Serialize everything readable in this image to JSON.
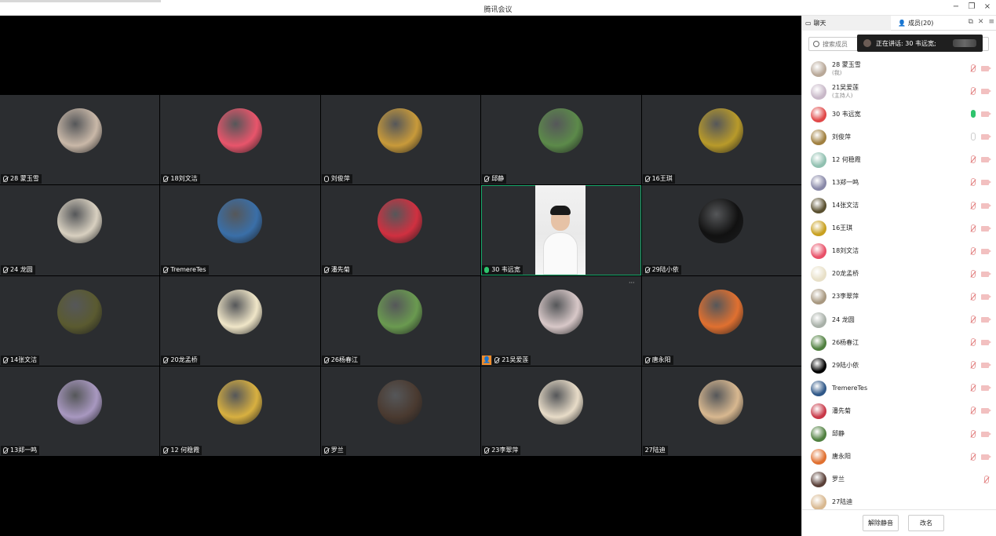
{
  "window": {
    "title": "腾讯会议",
    "controls": [
      "−",
      "❐",
      "×"
    ]
  },
  "colors": {
    "stage_bg": "#000000",
    "tile_bg": "#2b2d30",
    "active_border": "#1aad6f",
    "host_badge": "#f08c2a",
    "muted_red": "#e07070",
    "speaking_green": "#2ec46d"
  },
  "grid": {
    "tiles": [
      {
        "name": "28 蒙玉雪",
        "mic": "muted",
        "avatar_color": "#c9b8a8"
      },
      {
        "name": "18刘文洁",
        "mic": "muted",
        "avatar_color": "#e8556b"
      },
      {
        "name": "刘俊萍",
        "mic": "on",
        "avatar_color": "#c89a3a"
      },
      {
        "name": "邱静",
        "mic": "muted",
        "avatar_color": "#5c8a4a"
      },
      {
        "name": "16王琪",
        "mic": "muted",
        "avatar_color": "#b89a2a"
      },
      {
        "name": "24 龙圆",
        "mic": "muted",
        "avatar_color": "#d8d0c0"
      },
      {
        "name": "TremereTes",
        "mic": "muted",
        "avatar_color": "#3a6fa8"
      },
      {
        "name": "潘先菊",
        "mic": "muted",
        "avatar_color": "#d03040"
      },
      {
        "name": "30 韦远宽",
        "mic": "speaking",
        "video": true
      },
      {
        "name": "29陆小依",
        "mic": "muted",
        "avatar_color": "#111111"
      },
      {
        "name": "14张文洁",
        "mic": "muted",
        "avatar_color": "#5a5a30"
      },
      {
        "name": "20龙孟桥",
        "mic": "muted",
        "avatar_color": "#f0e6c8"
      },
      {
        "name": "26杨春江",
        "mic": "muted",
        "avatar_color": "#6a9a50"
      },
      {
        "name": "21吴爱莲",
        "mic": "muted",
        "host": true,
        "more": "···",
        "avatar_color": "#d8c8c8"
      },
      {
        "name": "唐永阳",
        "mic": "muted",
        "avatar_color": "#e07030"
      },
      {
        "name": "13郑一鸣",
        "mic": "muted",
        "avatar_color": "#a898c0"
      },
      {
        "name": "12 何稳霞",
        "mic": "muted",
        "avatar_color": "#d8b040"
      },
      {
        "name": "罗兰",
        "mic": "muted",
        "avatar_color": "#4a3a30"
      },
      {
        "name": "23李翠萍",
        "mic": "muted",
        "avatar_color": "#e8dcc8"
      },
      {
        "name": "27陆迪",
        "mic": "none",
        "avatar_color": "#d8b890"
      }
    ]
  },
  "panel": {
    "tabs": {
      "chat": "聊天",
      "members": "成员(20)"
    },
    "search_placeholder": "搜索成员",
    "speaking_label": "正在讲话: 30 韦远宽;",
    "members": [
      {
        "name": "28 蒙玉雪",
        "sub": "(我)",
        "mic": "muted",
        "color": "#b8a898"
      },
      {
        "name": "21吴爱莲",
        "sub": "(主持人)",
        "mic": "muted",
        "color": "#c8b8c8"
      },
      {
        "name": "30 韦远宽",
        "mic": "on",
        "color": "#e04848"
      },
      {
        "name": "刘俊萍",
        "mic": "gray",
        "color": "#a08040"
      },
      {
        "name": "12 何稳霞",
        "mic": "muted",
        "color": "#90c0b0"
      },
      {
        "name": "13郑一鸣",
        "mic": "muted",
        "color": "#8888a8"
      },
      {
        "name": "14张文洁",
        "mic": "muted",
        "color": "#5a5030"
      },
      {
        "name": "16王琪",
        "mic": "muted",
        "color": "#c8a020"
      },
      {
        "name": "18刘文洁",
        "mic": "muted",
        "color": "#e85068"
      },
      {
        "name": "20龙孟桥",
        "mic": "muted",
        "color": "#e8e0c8"
      },
      {
        "name": "23李翠萍",
        "mic": "muted",
        "color": "#a89880"
      },
      {
        "name": "24 龙圆",
        "mic": "muted",
        "color": "#a8b0a8"
      },
      {
        "name": "26杨春江",
        "mic": "muted",
        "color": "#508040"
      },
      {
        "name": "29陆小依",
        "mic": "muted",
        "color": "#000000"
      },
      {
        "name": "TremereTes",
        "mic": "muted",
        "color": "#305888"
      },
      {
        "name": "潘先菊",
        "mic": "muted",
        "color": "#c83848"
      },
      {
        "name": "邱静",
        "mic": "muted",
        "color": "#508040"
      },
      {
        "name": "唐永阳",
        "mic": "muted",
        "color": "#e07030"
      },
      {
        "name": "罗兰",
        "mic": "muted_only",
        "color": "#5a4038"
      },
      {
        "name": "27陆迪",
        "mic": "none",
        "color": "#d8b890"
      }
    ],
    "footer": {
      "unmute": "解除静音",
      "rename": "改名"
    }
  }
}
